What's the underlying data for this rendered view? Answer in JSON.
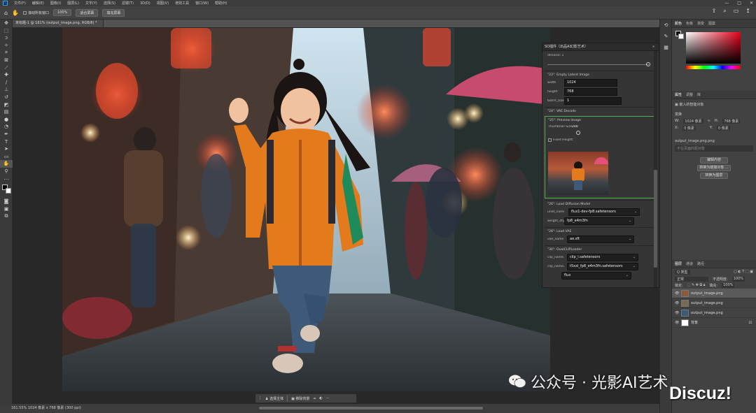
{
  "menubar": {
    "items": [
      "文件(F)",
      "编辑(E)",
      "图像(I)",
      "图层(L)",
      "文字(Y)",
      "选择(S)",
      "滤镜(T)",
      "3D(D)",
      "视图(V)",
      "增效工具",
      "窗口(W)",
      "帮助(H)"
    ],
    "window_controls": [
      "—",
      "□",
      "✕"
    ]
  },
  "options": {
    "scroll_all_label": "滚动所有窗口",
    "zoom_value": "100%",
    "fit_screen": "适合屏幕",
    "fill_screen": "填充屏幕"
  },
  "document": {
    "tab_title": "未标题-1 @ 161% (output_image.png, RGB/8) *"
  },
  "status": {
    "text": "161.55%   1024 像素 x 768 像素 (300 ppi)"
  },
  "context_bar": {
    "select_subject": "选择主体",
    "remove_bg": "移除背景"
  },
  "comfy": {
    "title": "SD插件（出品AI幻影艺术）",
    "denoise_label": "denoise: 1",
    "latent": {
      "header": "\"23\": Empty Latent Image",
      "width_label": "width",
      "width_value": "1024",
      "height_label": "height",
      "height_value": "768",
      "batch_label": "batch_size",
      "batch_value": "1"
    },
    "vae_decode_header": "\"24\": VAE Decode",
    "preview": {
      "header": "\"25\": Preview Image",
      "thumb_label": "Thumbnail Size:",
      "thumb_value": "200",
      "fixed_height": "Fixed Height:"
    },
    "diffusion": {
      "header": "\"26\": Load Diffusion Model",
      "unet_label": "unet_name",
      "unet_value": "flux1-dev-fp8.safetensors",
      "dtype_label": "weight_dtype",
      "dtype_value": "fp8_e4m3fn"
    },
    "vae": {
      "header": "\"28\": Load VAE",
      "label": "vae_name",
      "value": "ae.sft"
    },
    "clip": {
      "header": "\"30\": DualCLIPLoader",
      "clip1_label": "clip_name1",
      "clip1_value": "clip_l.safetensors",
      "clip2_label": "clip_name2",
      "clip2_value": "t5xxl_fp8_e4m3fn.safetensors",
      "type_value": "flux"
    }
  },
  "rightpanel": {
    "color_tabs": [
      "颜色",
      "色板",
      "渐变",
      "图案"
    ],
    "props_tabs": [
      "属性",
      "调整",
      "库"
    ],
    "props_type": "嵌入的智能对象",
    "transform_label": "变换",
    "w_label": "W:",
    "w_value": "1024 像素",
    "h_label": "H:",
    "h_value": "768 像素",
    "x_label": "X:",
    "x_value": "0 像素",
    "y_label": "Y:",
    "y_value": "0 像素",
    "file_label": "output_image.png.png",
    "placeholder": "不在页面匹配对象",
    "edit_btn": "编辑内容",
    "convert_btn": "转换为链接对象 ...",
    "layers_btn": "转换为图层",
    "layers_tabs": [
      "图层",
      "通道",
      "路径"
    ],
    "kind_label": "Q 类型",
    "blend": "正常",
    "opacity_label": "不透明度:",
    "opacity_value": "100%",
    "lock_label": "锁定:",
    "fill_label": "填充:",
    "fill_value": "100%",
    "layers": [
      "output_image.png",
      "output_image.png",
      "output_image.png",
      "背景"
    ]
  },
  "watermark": {
    "text": "公众号 · 光影AI艺术",
    "discuz": "Discuz!"
  },
  "colors": {
    "accent": "#31a8ff",
    "node_green": "#4caf50"
  }
}
